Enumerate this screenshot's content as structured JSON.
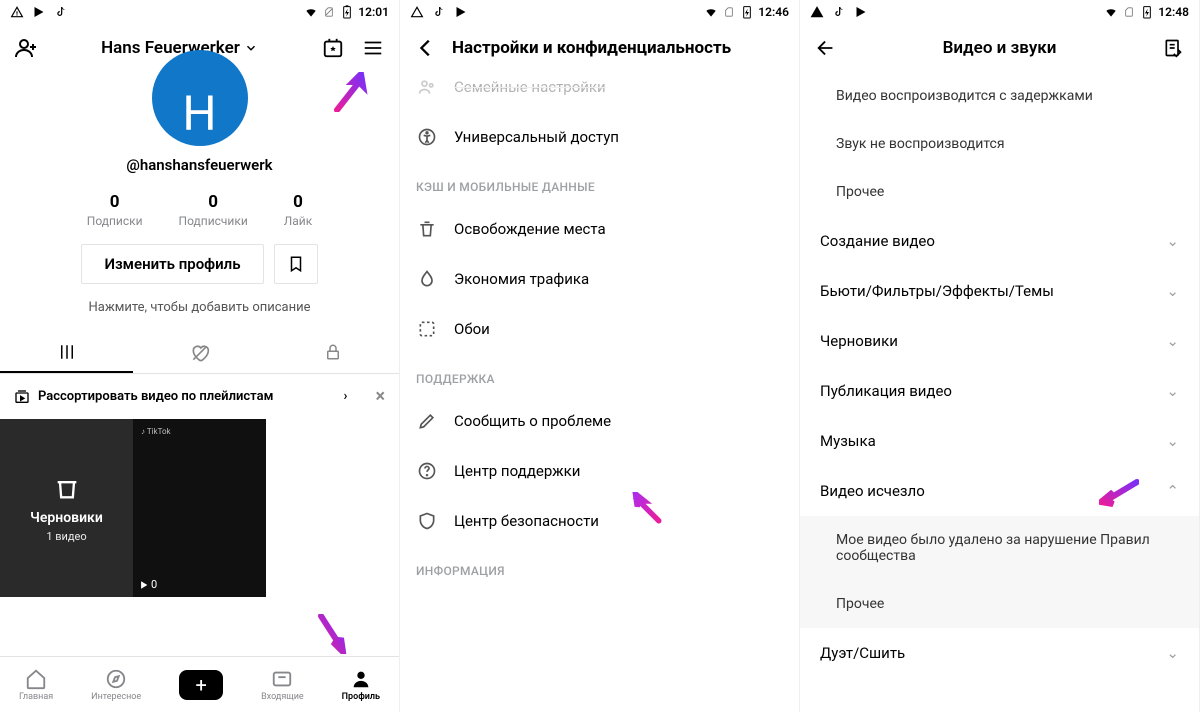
{
  "screen1": {
    "status": {
      "time": "12:01"
    },
    "profileName": "Hans Feuerwerker",
    "avatarLetter": "H",
    "username": "@hanshansfeuerwerk",
    "stats": [
      {
        "num": "0",
        "lbl": "Подписки"
      },
      {
        "num": "0",
        "lbl": "Подписчики"
      },
      {
        "num": "0",
        "lbl": "Лайк"
      }
    ],
    "editBtn": "Изменить профиль",
    "bioHint": "Нажмите, чтобы добавить описание",
    "playlistSort": "Рассортировать видео по плейлистам",
    "drafts": {
      "title": "Черновики",
      "sub": "1 видео"
    },
    "videoPlays": "0",
    "nav": {
      "home": "Главная",
      "discover": "Интересное",
      "inbox": "Входящие",
      "profile": "Профиль"
    }
  },
  "screen2": {
    "status": {
      "time": "12:46"
    },
    "title": "Настройки и конфиденциальность",
    "items": {
      "family": "Семейные настройки",
      "access": "Универсальный доступ"
    },
    "sectionCache": "КЭШ И МОБИЛЬНЫЕ ДАННЫЕ",
    "cacheItems": {
      "free": "Освобождение места",
      "data": "Экономия трафика",
      "wallpaper": "Обои"
    },
    "sectionSupport": "ПОДДЕРЖКА",
    "supportItems": {
      "report": "Сообщить о проблеме",
      "help": "Центр поддержки",
      "safety": "Центр безопасности"
    },
    "sectionInfo": "ИНФОРМАЦИЯ"
  },
  "screen3": {
    "status": {
      "time": "12:48"
    },
    "title": "Видео и звуки",
    "topItems": {
      "lag": "Видео воспроизводится с задержками",
      "nosound": "Звук не воспроизводится",
      "other1": "Прочее"
    },
    "collapsible": {
      "create": "Создание видео",
      "beauty": "Бьюти/Фильтры/Эффекты/Темы",
      "drafts": "Черновики",
      "publish": "Публикация видео",
      "music": "Музыка",
      "missing": "Видео исчезло",
      "removed": "Мое видео было удалено за нарушение Правил сообщества",
      "other2": "Прочее",
      "duet": "Дуэт/Сшить"
    }
  }
}
